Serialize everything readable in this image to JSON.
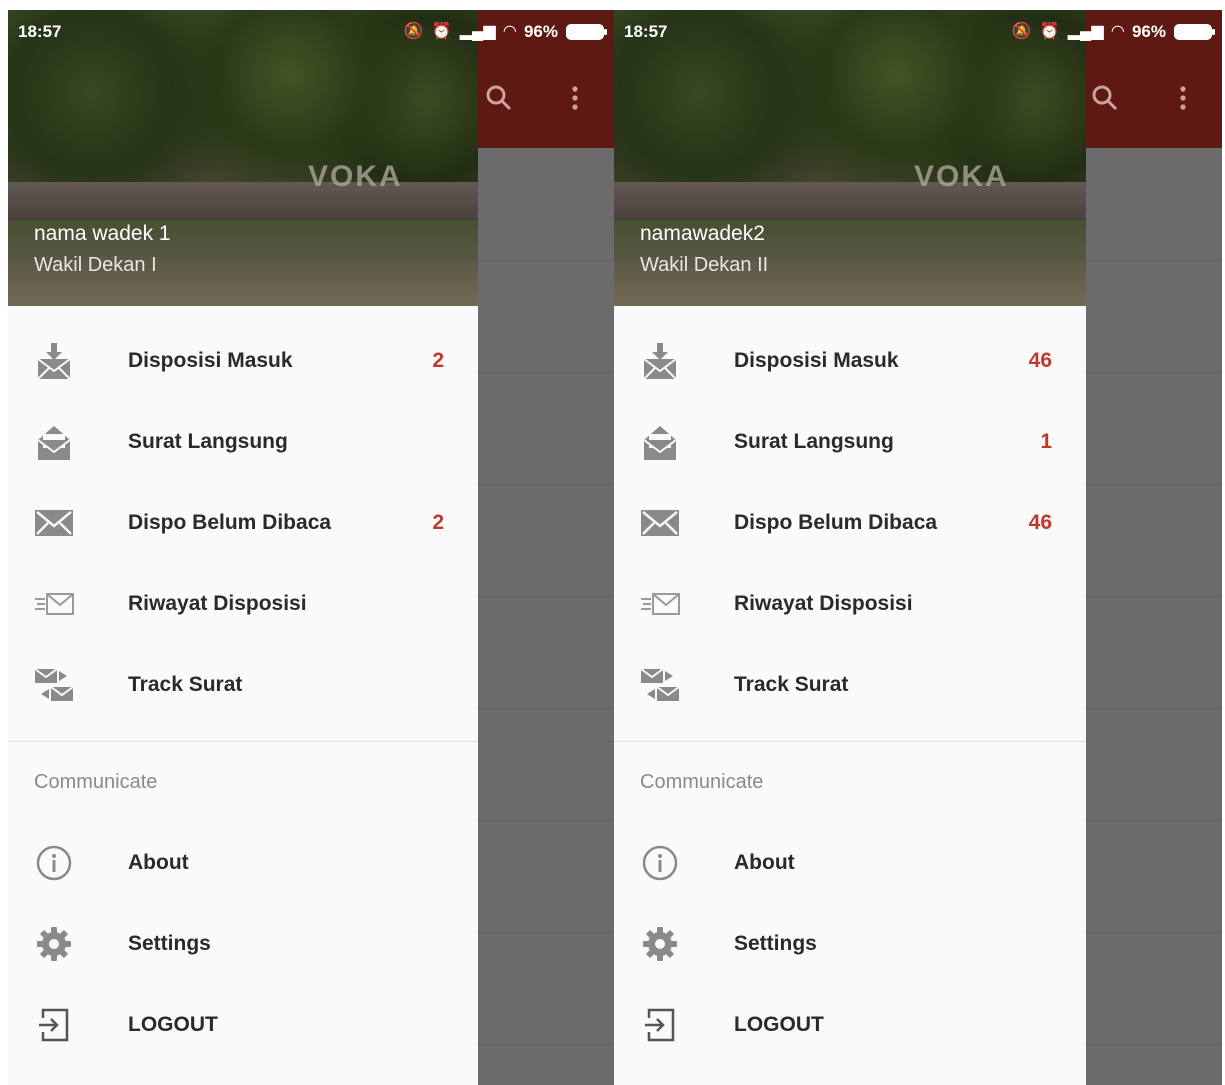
{
  "screens": [
    {
      "status": {
        "time": "18:57",
        "battery": "96%"
      },
      "user": {
        "name": "nama wadek 1",
        "role": "Wakil Dekan I"
      },
      "menu": [
        {
          "label": "Disposisi Masuk",
          "badge": "2",
          "icon": "inbox-mail-icon"
        },
        {
          "label": "Surat Langsung",
          "badge": "",
          "icon": "open-envelope-icon"
        },
        {
          "label": "Dispo Belum Dibaca",
          "badge": "2",
          "icon": "unread-envelope-icon"
        },
        {
          "label": "Riwayat Disposisi",
          "badge": "",
          "icon": "sent-mail-icon"
        },
        {
          "label": "Track Surat",
          "badge": "",
          "icon": "track-mail-icon"
        }
      ],
      "section_title": "Communicate",
      "menu2": [
        {
          "label": "About",
          "icon": "info-icon"
        },
        {
          "label": "Settings",
          "icon": "gear-icon"
        },
        {
          "label": "LOGOUT",
          "icon": "logout-icon"
        }
      ]
    },
    {
      "status": {
        "time": "18:57",
        "battery": "96%"
      },
      "user": {
        "name": "namawadek2",
        "role": "Wakil Dekan II"
      },
      "menu": [
        {
          "label": "Disposisi Masuk",
          "badge": "46",
          "icon": "inbox-mail-icon"
        },
        {
          "label": "Surat Langsung",
          "badge": "1",
          "icon": "open-envelope-icon"
        },
        {
          "label": "Dispo Belum Dibaca",
          "badge": "46",
          "icon": "unread-envelope-icon"
        },
        {
          "label": "Riwayat Disposisi",
          "badge": "",
          "icon": "sent-mail-icon"
        },
        {
          "label": "Track Surat",
          "badge": "",
          "icon": "track-mail-icon"
        }
      ],
      "section_title": "Communicate",
      "menu2": [
        {
          "label": "About",
          "icon": "info-icon"
        },
        {
          "label": "Settings",
          "icon": "gear-icon"
        },
        {
          "label": "LOGOUT",
          "icon": "logout-icon"
        }
      ]
    }
  ],
  "colors": {
    "appbar": "#5e1a12",
    "badge": "#c0392b",
    "drawer_bg": "#fafafa"
  }
}
